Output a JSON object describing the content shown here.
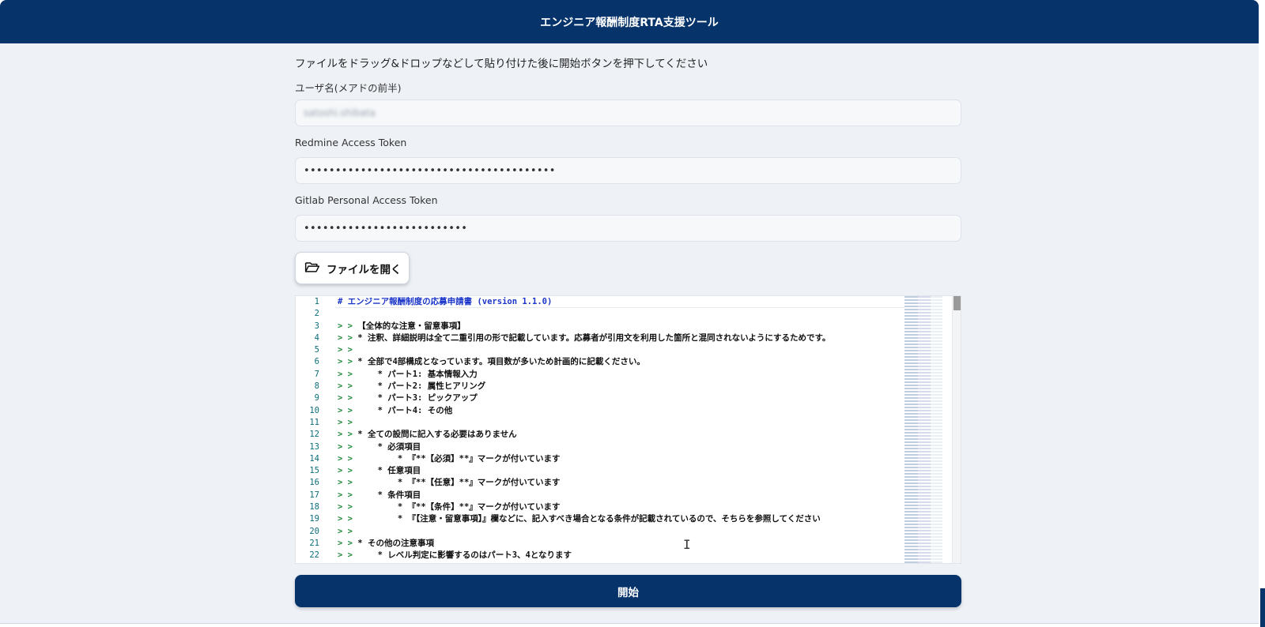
{
  "header": {
    "title": "エンジニア報酬制度RTA支援ツール"
  },
  "form": {
    "instruction": "ファイルをドラッグ&ドロップなどして貼り付けた後に開始ボタンを押下してください",
    "username_label": "ユーザ名(メアドの前半)",
    "username_value": "satoshi.shibata",
    "redmine_label": "Redmine Access Token",
    "redmine_value": "••••••••••••••••••••••••••••••••••••••••",
    "gitlab_label": "Gitlab Personal Access Token",
    "gitlab_value": "••••••••••••••••••••••••••",
    "open_file_label": "ファイルを開く",
    "start_label": "開始"
  },
  "icons": {
    "open_file": "folder-open-icon",
    "text_cursor": "i-beam-cursor-icon"
  },
  "colors": {
    "primary": "#05336a",
    "background": "#eef2f7",
    "heading": "#1a35c9",
    "quote": "#1f8a3a",
    "line_number": "#0b6e7a"
  },
  "editor": {
    "lines": [
      {
        "num": "1",
        "heading": "# エンジニア報酬制度の応募申請書 (version 1.1.0)"
      },
      {
        "num": "2"
      },
      {
        "num": "3",
        "quote": "> > ",
        "text": "【全体的な注意・留意事項】"
      },
      {
        "num": "4",
        "quote": "> > ",
        "text": "* 注釈、詳細説明は全て二重引用の形で記載しています。応募者が引用文を利用した箇所と混同されないようにするためです。"
      },
      {
        "num": "5",
        "quote": "> >"
      },
      {
        "num": "6",
        "quote": "> > ",
        "text": "* 全部で4部構成となっています。項目数が多いため計画的に記載ください。"
      },
      {
        "num": "7",
        "quote": "> > ",
        "text": "    * パート1: 基本情報入力"
      },
      {
        "num": "8",
        "quote": "> > ",
        "text": "    * パート2: 属性ヒアリング"
      },
      {
        "num": "9",
        "quote": "> > ",
        "text": "    * パート3: ピックアップ"
      },
      {
        "num": "10",
        "quote": "> > ",
        "text": "    * パート4: その他"
      },
      {
        "num": "11",
        "quote": "> >"
      },
      {
        "num": "12",
        "quote": "> > ",
        "text": "* 全ての設問に記入する必要はありません"
      },
      {
        "num": "13",
        "quote": "> > ",
        "text": "    * 必須項目"
      },
      {
        "num": "14",
        "quote": "> > ",
        "text": "        * 『**【必須】**』マークが付いています"
      },
      {
        "num": "15",
        "quote": "> > ",
        "text": "    * 任意項目"
      },
      {
        "num": "16",
        "quote": "> > ",
        "text": "        * 『**【任意】**』マークが付いています"
      },
      {
        "num": "17",
        "quote": "> > ",
        "text": "    * 条件項目"
      },
      {
        "num": "18",
        "quote": "> > ",
        "text": "        * 『**【条件】**』マークが付いています"
      },
      {
        "num": "19",
        "quote": "> > ",
        "text": "        * 『【注意・留意事項】』欄などに、記入すべき場合となる条件が記載されているので、そちらを参照してください"
      },
      {
        "num": "20",
        "quote": "> >"
      },
      {
        "num": "21",
        "quote": "> > ",
        "text": "* その他の注意事項"
      },
      {
        "num": "22",
        "quote": "> > ",
        "text": "    * レベル判定に影響するのはパート3、4となります"
      }
    ]
  }
}
